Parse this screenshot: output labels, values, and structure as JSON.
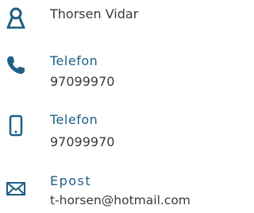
{
  "contact": {
    "name": "Thorsen Vidar",
    "phone": {
      "label": "Telefon",
      "value": "97099970"
    },
    "mobile": {
      "label": "Telefon",
      "value": "97099970"
    },
    "email": {
      "label": "Epost",
      "value": "t-horsen@hotmail.com"
    }
  },
  "icons": {
    "person": "person-icon",
    "phone": "phone-icon",
    "mobile": "mobile-phone-icon",
    "email": "envelope-icon"
  },
  "colors": {
    "icon": "#1f5f85",
    "label": "#1f5f85",
    "text": "#3a3a3a"
  }
}
